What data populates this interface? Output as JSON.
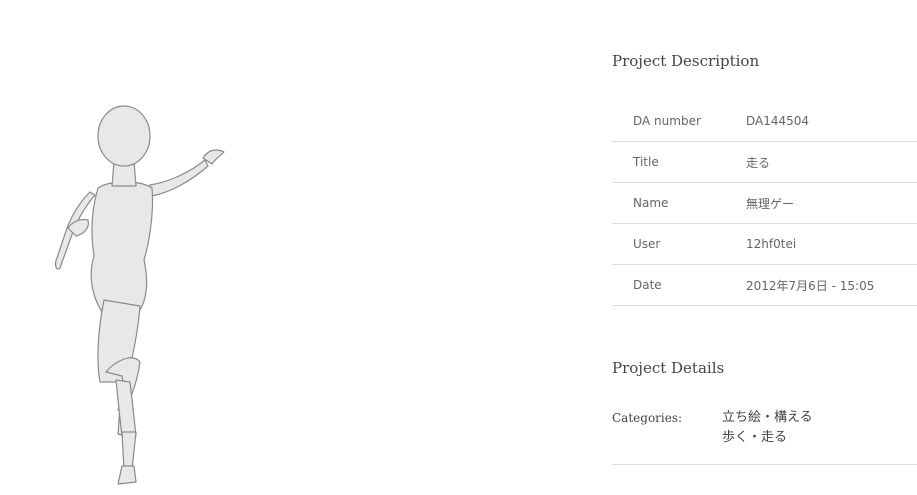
{
  "description": {
    "title": "Project Description",
    "rows": [
      {
        "label": "DA number",
        "value": "DA144504"
      },
      {
        "label": "Title",
        "value": "走る"
      },
      {
        "label": "Name",
        "value": "無理ゲー"
      },
      {
        "label": "User",
        "value": "12hf0tei"
      },
      {
        "label": "Date",
        "value": "2012年7月6日 - 15:05"
      }
    ]
  },
  "details": {
    "title": "Project Details",
    "categories_label": "Categories:",
    "categories": [
      "立ち絵・構える",
      "歩く・走る"
    ]
  },
  "colors": {
    "figure_fill": "#e8e8e6",
    "figure_stroke": "#8a8a88",
    "divider": "#dcdcdc"
  }
}
